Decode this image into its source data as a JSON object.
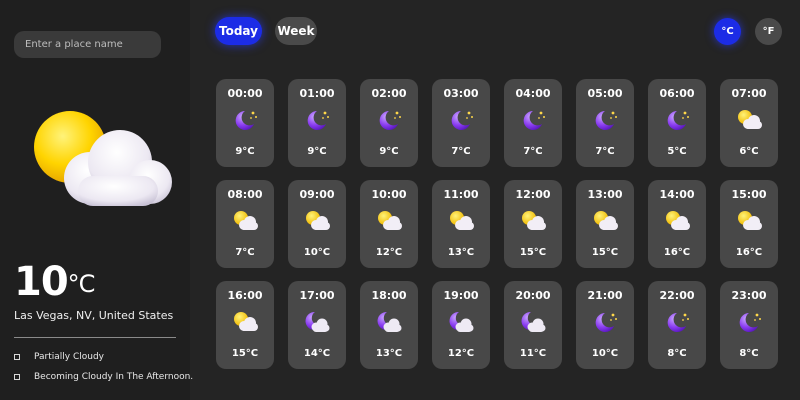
{
  "search": {
    "placeholder": "Enter a place name"
  },
  "current": {
    "temperature": "10",
    "unit": "°C",
    "location": "Las Vegas, NV, United States",
    "icon": "partly-cloudy-day-icon",
    "conditions": [
      "Partially Cloudy",
      "Becoming Cloudy In The Afternoon."
    ]
  },
  "tabs": {
    "today": "Today",
    "week": "Week"
  },
  "units": {
    "celsius": "°C",
    "fahrenheit": "°F"
  },
  "colors": {
    "accent": "#1c2ce6",
    "card": "#484848",
    "background": "#242424"
  },
  "hourly": [
    {
      "time": "00:00",
      "temp": "9°C",
      "icon": "moon-icon"
    },
    {
      "time": "01:00",
      "temp": "9°C",
      "icon": "moon-icon"
    },
    {
      "time": "02:00",
      "temp": "9°C",
      "icon": "moon-icon"
    },
    {
      "time": "03:00",
      "temp": "7°C",
      "icon": "moon-icon"
    },
    {
      "time": "04:00",
      "temp": "7°C",
      "icon": "moon-icon"
    },
    {
      "time": "05:00",
      "temp": "7°C",
      "icon": "moon-icon"
    },
    {
      "time": "06:00",
      "temp": "5°C",
      "icon": "moon-icon"
    },
    {
      "time": "07:00",
      "temp": "6°C",
      "icon": "sun-cloud-icon"
    },
    {
      "time": "08:00",
      "temp": "7°C",
      "icon": "sun-cloud-icon"
    },
    {
      "time": "09:00",
      "temp": "10°C",
      "icon": "sun-cloud-icon"
    },
    {
      "time": "10:00",
      "temp": "12°C",
      "icon": "sun-cloud-icon"
    },
    {
      "time": "11:00",
      "temp": "13°C",
      "icon": "sun-cloud-icon"
    },
    {
      "time": "12:00",
      "temp": "15°C",
      "icon": "sun-cloud-icon"
    },
    {
      "time": "13:00",
      "temp": "15°C",
      "icon": "sun-cloud-icon"
    },
    {
      "time": "14:00",
      "temp": "16°C",
      "icon": "sun-cloud-icon"
    },
    {
      "time": "15:00",
      "temp": "16°C",
      "icon": "sun-cloud-icon"
    },
    {
      "time": "16:00",
      "temp": "15°C",
      "icon": "sun-cloud-icon"
    },
    {
      "time": "17:00",
      "temp": "14°C",
      "icon": "moon-cloud-icon"
    },
    {
      "time": "18:00",
      "temp": "13°C",
      "icon": "moon-cloud-icon"
    },
    {
      "time": "19:00",
      "temp": "12°C",
      "icon": "moon-cloud-icon"
    },
    {
      "time": "20:00",
      "temp": "11°C",
      "icon": "moon-cloud-icon"
    },
    {
      "time": "21:00",
      "temp": "10°C",
      "icon": "moon-icon"
    },
    {
      "time": "22:00",
      "temp": "8°C",
      "icon": "moon-icon"
    },
    {
      "time": "23:00",
      "temp": "8°C",
      "icon": "moon-icon"
    }
  ]
}
